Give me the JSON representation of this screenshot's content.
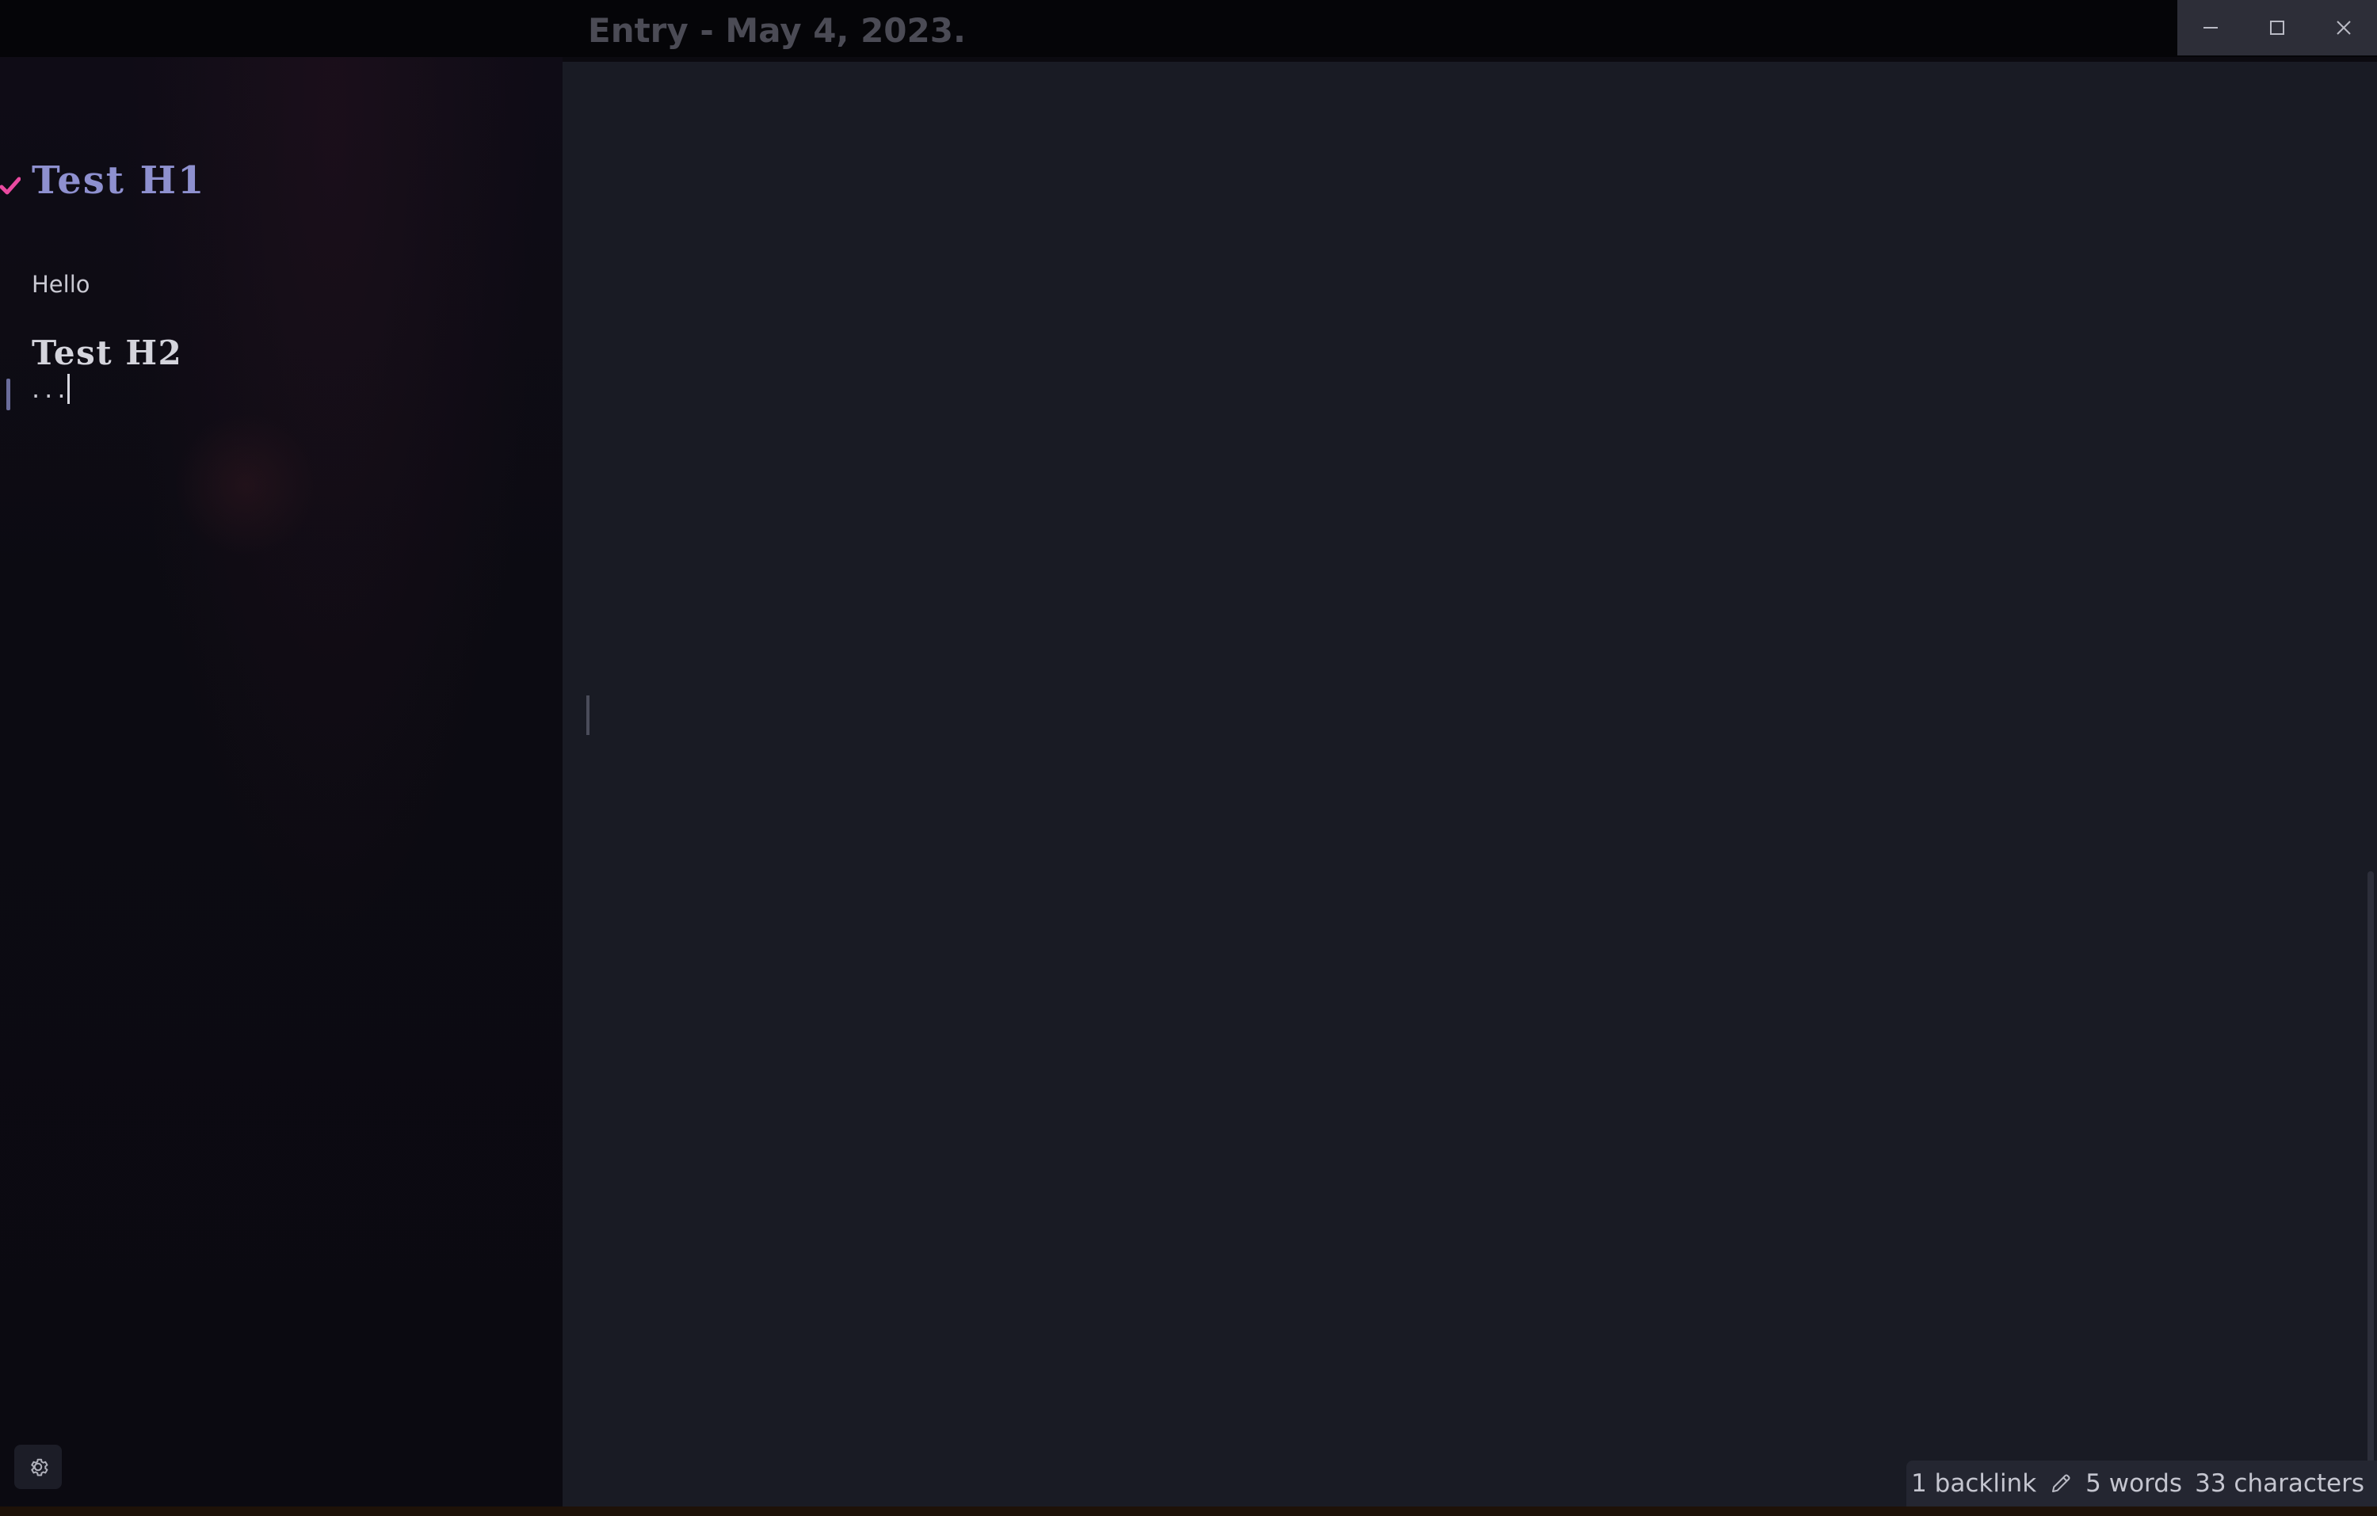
{
  "window": {
    "title": "Entry - May 4, 2023."
  },
  "outline": {
    "h1": "Test H1",
    "h1_text": "Hello",
    "h2": "Test H2",
    "h2_text": "...",
    "h1_check_color": "#e94aa0"
  },
  "statusbar": {
    "backlinks": "1 backlink",
    "words": "5 words",
    "characters": "33 characters"
  },
  "icons": {
    "minimize": "minimize-icon",
    "maximize": "maximize-icon",
    "close": "close-icon",
    "settings": "gear-icon",
    "check": "check-icon",
    "edit": "pencil-icon"
  },
  "colors": {
    "h1": "#8e90cf",
    "editor_background": "#191b24",
    "sidebar_background": "#0c0b12"
  }
}
